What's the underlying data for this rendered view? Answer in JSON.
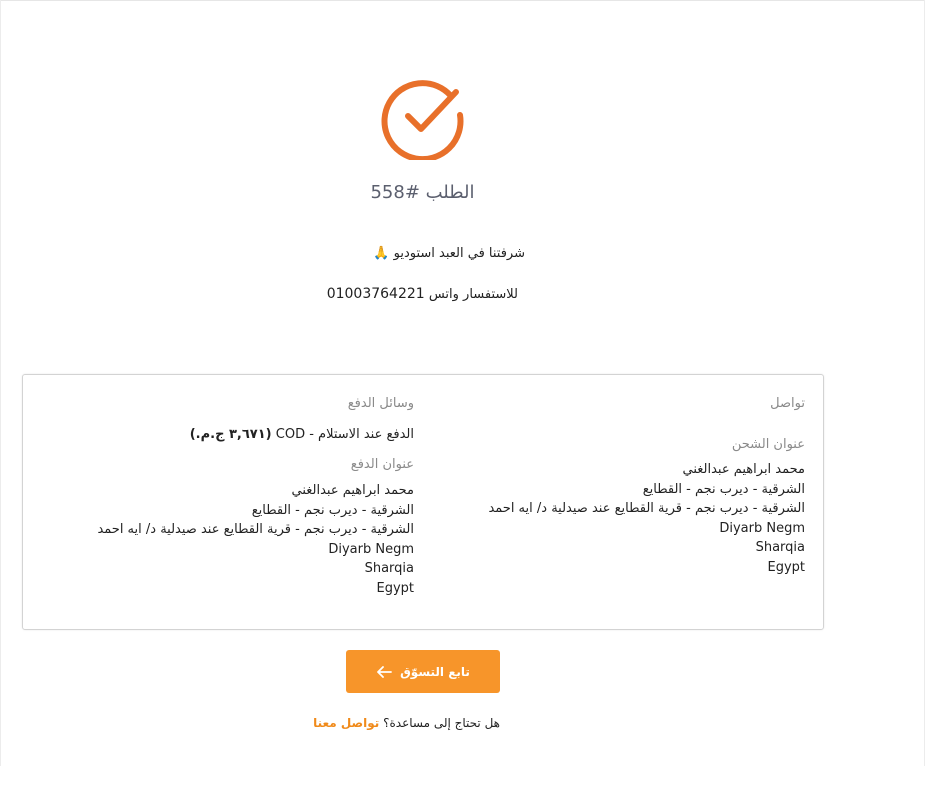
{
  "order": {
    "title": "الطلب #558"
  },
  "message": {
    "thanks": "شرفتنا في العبد استوديو",
    "thanks_emoji": "🙏",
    "whatsapp_label": "للاستفسار واتس",
    "whatsapp_number": "01003764221"
  },
  "details": {
    "contact_label": "تواصل",
    "shipping_label": "عنوان الشحن",
    "shipping_lines": [
      "محمد ابراهيم عبدالغني",
      "الشرقية - ديرب نجم - القطايع",
      "الشرقية - ديرب نجم - قرية القطايع عند صيدلية د/ ايه احمد",
      "Diyarb Negm",
      "Sharqia",
      "Egypt"
    ],
    "payment_methods_label": "وسائل الدفع",
    "payment_method": "الدفع عند الاستلام - COD",
    "payment_amount": "(٣,٦٧١ ج.م.)",
    "billing_label": "عنوان الدفع",
    "billing_lines": [
      "محمد ابراهيم عبدالغني",
      "الشرقية - ديرب نجم - القطايع",
      "الشرقية - ديرب نجم - قرية القطايع عند صيدلية د/ ايه احمد",
      "Diyarb Negm",
      "Sharqia",
      "Egypt"
    ]
  },
  "actions": {
    "continue_label": "تابع التسوّق",
    "help_question": "هل تحتاج إلى مساعدة؟",
    "help_link": "تواصل معنا"
  },
  "colors": {
    "accent": "#f7952a",
    "check": "#e8702a"
  }
}
